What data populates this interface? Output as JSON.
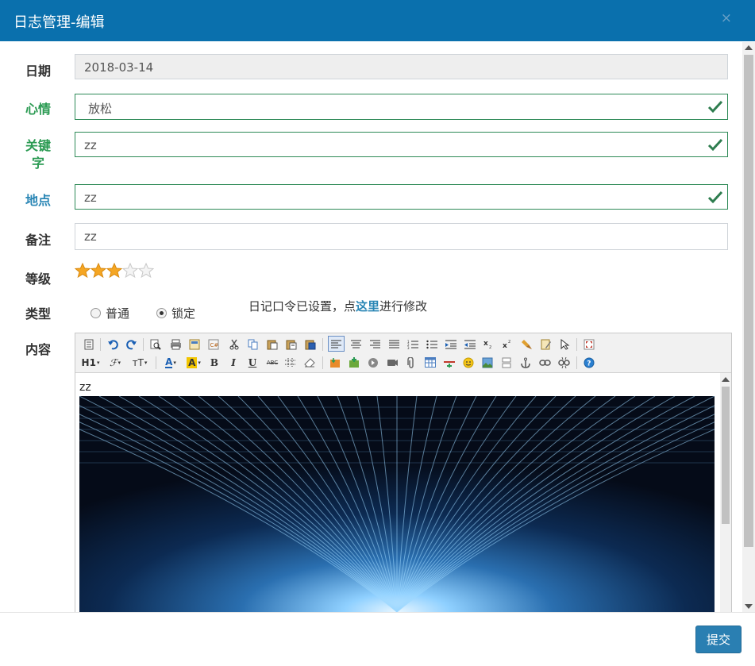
{
  "dialog": {
    "title": "日志管理-编辑",
    "close_glyph": "×"
  },
  "form": {
    "date": {
      "label": "日期",
      "value": "2018-03-14"
    },
    "mood": {
      "label": "心情",
      "value": "放松"
    },
    "keyword": {
      "label_line1": "关键",
      "label_line2": "字",
      "value": "zz"
    },
    "place": {
      "label": "地点",
      "value": "zz"
    },
    "note": {
      "label": "备注",
      "value": "zz"
    },
    "level": {
      "label": "等级",
      "rating": 3,
      "max": 5
    },
    "type": {
      "label": "类型",
      "options": [
        "普通",
        "锁定"
      ],
      "selected": "锁定"
    },
    "password_note": {
      "prefix": "日记口令已设置，点",
      "link": "这里",
      "suffix": "进行修改"
    },
    "content": {
      "label": "内容",
      "text": "zz"
    }
  },
  "toolbar": {
    "h1": "H1",
    "font": "ℱ",
    "size": "тT",
    "forecolor": "A",
    "backcolor": "A",
    "bold": "B",
    "italic": "I",
    "underline": "U",
    "strike": "ABC"
  },
  "colors": {
    "header": "#0a70ad",
    "valid": "#2e8a57",
    "star": "#f5a623"
  },
  "footer": {
    "submit_label": "提交"
  }
}
